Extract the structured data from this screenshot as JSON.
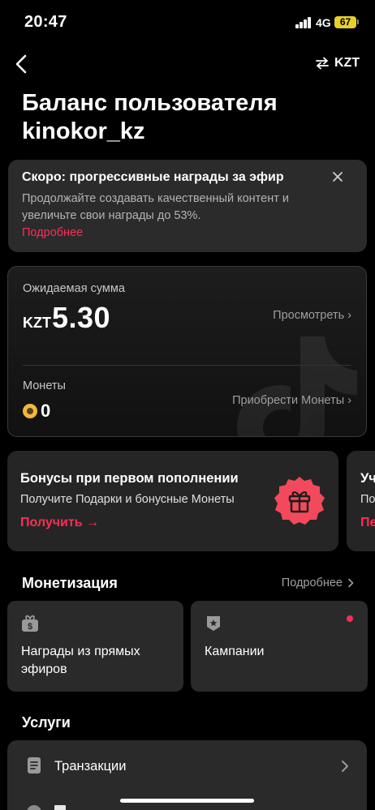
{
  "status_bar": {
    "time": "20:47",
    "network": "4G",
    "battery": "67"
  },
  "nav": {
    "currency": "KZT"
  },
  "page": {
    "title": "Баланс пользователя kinokor_kz"
  },
  "notice": {
    "title": "Скоро: прогрессивные награды за эфир",
    "text": "Продолжайте создавать качественный контент и увеличьте свои награды до 53%.",
    "link": "Подробнее"
  },
  "balance": {
    "expected_label": "Ожидаемая сумма",
    "currency": "KZT",
    "amount": "5.30",
    "view_link": "Просмотреть ›",
    "coins_label": "Монеты",
    "coins_value": "0",
    "buy_link": "Приобрести Монеты ›"
  },
  "promo": {
    "title": "Бонусы при первом пополнении",
    "subtitle": "Получите Подарки и бонусные Монеты",
    "link": "Получить →"
  },
  "promo2": {
    "title": "Уч",
    "subtitle": "По",
    "link": "Пе"
  },
  "monetization": {
    "title": "Монетизация",
    "more": "Подробнее",
    "tiles": [
      {
        "label": "Награды из прямых эфиров",
        "icon": "gift-dollar-icon"
      },
      {
        "label": "Кампании",
        "icon": "campaign-badge-icon",
        "has_dot": true
      }
    ]
  },
  "services": {
    "title": "Услуги",
    "items": [
      {
        "label": "Транзакции",
        "icon": "document-icon"
      }
    ]
  },
  "colors": {
    "accent": "#fe2c55",
    "card": "#2a2a2a",
    "battery": "#e7cf2c"
  }
}
